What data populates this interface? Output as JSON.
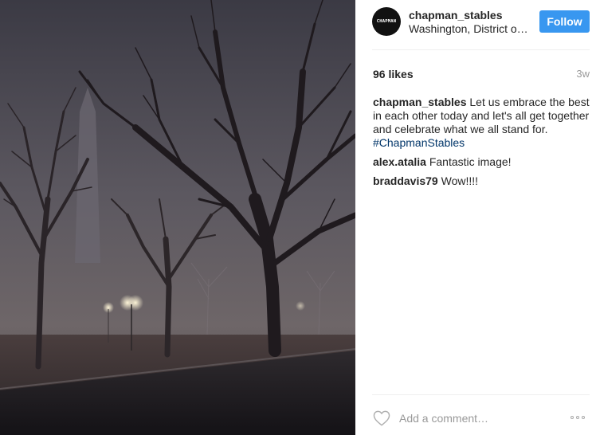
{
  "post": {
    "username": "chapman_stables",
    "location": "Washington, District of Columbia",
    "avatar_text": "CHAPMAN",
    "follow_label": "Follow",
    "likes": "96 likes",
    "age": "3w"
  },
  "comments": [
    {
      "user": "chapman_stables",
      "text": "Let us embrace the best in each other today and let's all get together and celebrate what we all stand for. ",
      "hashtag": "#ChapmanStables"
    },
    {
      "user": "alex.atalia",
      "text": "Fantastic image!"
    },
    {
      "user": "braddavis79",
      "text": "Wow!!!!"
    }
  ],
  "footer": {
    "placeholder": "Add a comment…",
    "heart_icon": "heart-outline-icon",
    "more_icon": "more-options-icon"
  },
  "colors": {
    "follow_button": "#3897f0",
    "hashtag": "#003569",
    "muted": "#999999",
    "divider": "#efefef"
  }
}
